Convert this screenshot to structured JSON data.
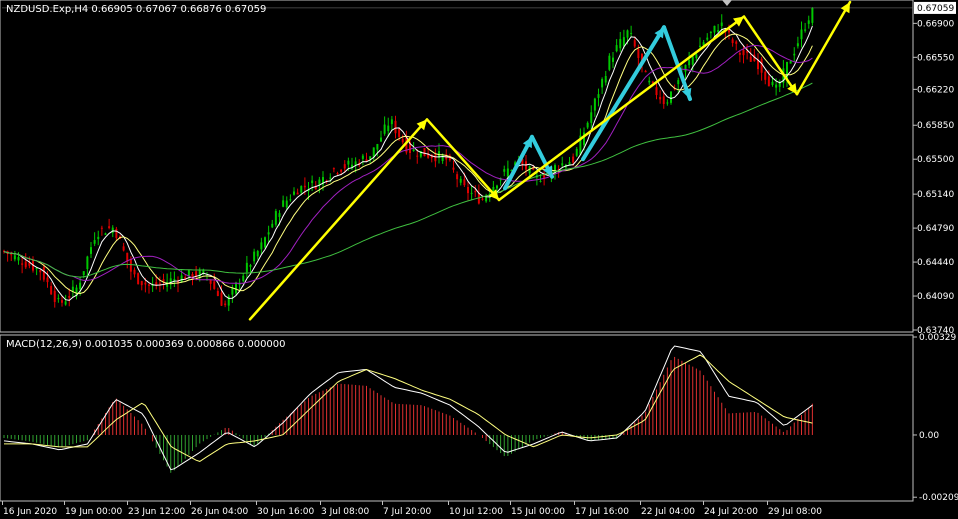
{
  "colors": {
    "background": "#000000",
    "frame": "#c0c0c0",
    "grid": "#404040",
    "bull": "#00c800",
    "bear": "#e00000",
    "ma_fast": "#ffffff",
    "ma_mid": "#ffff80",
    "ma_purple": "#a020c0",
    "ma_slow": "#40c040",
    "arrow_yellow": "#ffff00",
    "arrow_cyan": "#33ccdd",
    "macd_hist_pos": "#e03030",
    "macd_hist_neg": "#30a030",
    "macd_line": "#ffffff",
    "macd_signal": "#ffff80"
  },
  "icons": {
    "collapse": "triangle-down-icon"
  },
  "chart_data": [
    {
      "type": "candlestick",
      "title": "NZDUSD.Exp,H4  0.66905 0.67067 0.66876 0.67059",
      "current_price_label": "0.67059",
      "ylim": [
        0.6374,
        0.6712
      ],
      "y_ticks": [
        "0.66900",
        "0.66550",
        "0.66220",
        "0.65850",
        "0.65500",
        "0.65140",
        "0.64790",
        "0.64440",
        "0.64090",
        "0.63740"
      ],
      "y_tick_values": [
        0.669,
        0.6655,
        0.6622,
        0.6585,
        0.655,
        0.6514,
        0.6479,
        0.6444,
        0.6409,
        0.6374
      ],
      "x_ticks": [
        "16 Jun 2020",
        "19 Jun 00:00",
        "23 Jun 12:00",
        "26 Jun 04:00",
        "30 Jun 16:00",
        "3 Jul 08:00",
        "7 Jul 20:00",
        "10 Jul 12:00",
        "15 Jul 00:00",
        "17 Jul 16:00",
        "22 Jul 04:00",
        "24 Jul 20:00",
        "29 Jul 08:00"
      ],
      "close_anchors": [
        0.6455,
        0.6445,
        0.6435,
        0.64,
        0.6418,
        0.6475,
        0.648,
        0.643,
        0.6418,
        0.6425,
        0.643,
        0.6432,
        0.6398,
        0.6432,
        0.646,
        0.65,
        0.652,
        0.6525,
        0.654,
        0.6545,
        0.6555,
        0.659,
        0.656,
        0.6555,
        0.6552,
        0.652,
        0.6508,
        0.6532,
        0.6548,
        0.653,
        0.6542,
        0.655,
        0.66,
        0.6655,
        0.6682,
        0.663,
        0.6608,
        0.6642,
        0.667,
        0.669,
        0.666,
        0.665,
        0.662,
        0.6662,
        0.6706
      ],
      "series": [
        {
          "kind": "ma",
          "period": 5
        },
        {
          "kind": "ma",
          "period": 10
        },
        {
          "kind": "ma",
          "period": 20
        },
        {
          "kind": "ma",
          "period": 80
        }
      ],
      "annotations": {
        "yellow_arrows": [
          {
            "from": [
              "30 Jun",
              0.6385
            ],
            "to": [
              "7 Jul",
              0.6591
            ]
          },
          {
            "from": [
              "7 Jul",
              0.6591
            ],
            "to": [
              "14 Jul",
              0.6508
            ]
          },
          {
            "from": [
              "14 Jul",
              0.6508
            ],
            "to": [
              "24 Jul",
              0.6697
            ]
          },
          {
            "from": [
              "24 Jul",
              0.6697
            ],
            "to": [
              "29 Jul",
              0.6617
            ]
          },
          {
            "from": [
              "29 Jul",
              0.6617
            ],
            "to": [
              "31 Jul",
              0.6712
            ]
          }
        ],
        "cyan_arrows": [
          {
            "from": [
              "14 Jul",
              0.652
            ],
            "to": [
              "15 Jul",
              0.6573
            ]
          },
          {
            "from": [
              "15 Jul",
              0.6573
            ],
            "to": [
              "16 Jul",
              0.6532
            ]
          },
          {
            "from": [
              "17 Jul",
              0.655
            ],
            "to": [
              "22 Jul",
              0.6686
            ]
          },
          {
            "from": [
              "22 Jul",
              0.6686
            ],
            "to": [
              "23 Jul",
              0.6612
            ]
          }
        ]
      }
    },
    {
      "type": "bar",
      "title": "MACD(12,26,9) 0.001035 0.000369 0.000866 0.000000",
      "ylim": [
        -0.00215,
        0.00329
      ],
      "y_ticks": [
        "0.00329",
        "0.00",
        "-0.00209"
      ],
      "y_tick_values": [
        0.00329,
        0.0,
        -0.00209
      ],
      "macd_anchors": [
        -0.0002,
        -0.0003,
        -0.0005,
        -0.0003,
        0.0012,
        0.0007,
        -0.0012,
        -0.0006,
        0.0001,
        -0.0004,
        0.0004,
        0.0014,
        0.0021,
        0.0022,
        0.0016,
        0.0014,
        0.001,
        0.0003,
        -0.0006,
        -0.0003,
        0.0001,
        -0.0002,
        -0.0001,
        0.0008,
        0.003,
        0.0028,
        0.0013,
        0.0011,
        0.0003,
        0.001
      ],
      "signal_anchors": [
        -0.0003,
        -0.0003,
        -0.0004,
        -0.0004,
        0.0005,
        0.0011,
        -0.0004,
        -0.0009,
        -0.0003,
        -0.0002,
        0.0,
        0.0009,
        0.0018,
        0.0022,
        0.0019,
        0.0015,
        0.0012,
        0.0007,
        0.0,
        -0.0004,
        0.0,
        -0.0001,
        0.0,
        0.0005,
        0.0022,
        0.0027,
        0.0018,
        0.0012,
        0.0006,
        0.0004
      ]
    }
  ]
}
